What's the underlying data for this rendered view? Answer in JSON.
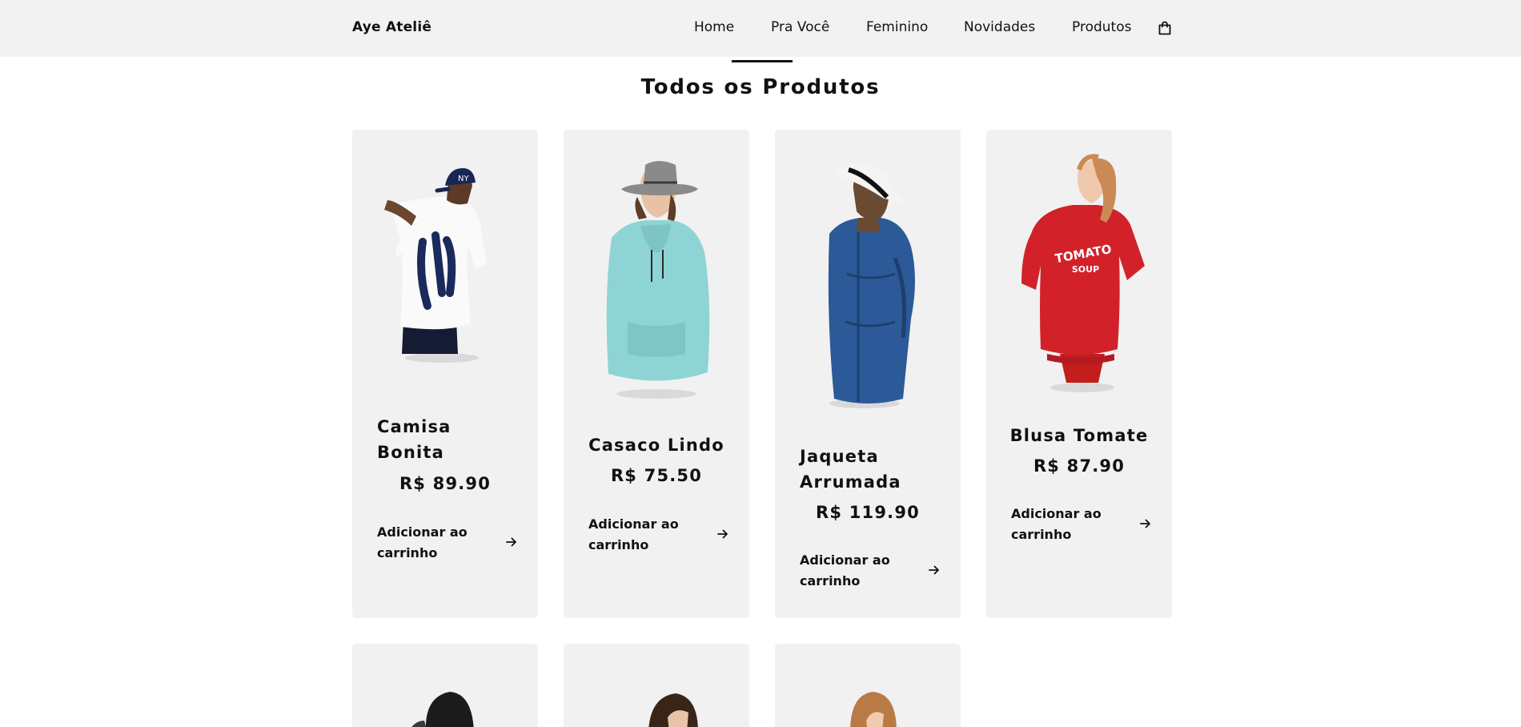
{
  "header": {
    "brand": "Aye Ateliê",
    "nav": [
      {
        "label": "Home"
      },
      {
        "label": "Pra Você"
      },
      {
        "label": "Feminino"
      },
      {
        "label": "Novidades"
      },
      {
        "label": "Produtos"
      }
    ],
    "cart_icon": "shopping-bag-icon"
  },
  "main": {
    "title": "Todos os Produtos",
    "add_to_cart_label": "Adicionar ao carrinho",
    "add_icon": "arrow-right-icon",
    "products": [
      {
        "name": "Camisa Bonita",
        "price": "R$ 89.90",
        "image": "man-white-ny-shirt-cap"
      },
      {
        "name": "Casaco Lindo",
        "price": "R$ 75.50",
        "image": "man-mint-hoodie-hat"
      },
      {
        "name": "Jaqueta Arrumada",
        "price": "R$ 119.90",
        "image": "man-denim-jacket-hat"
      },
      {
        "name": "Blusa Tomate",
        "price": "R$ 87.90",
        "image": "woman-red-tomato-soup-sweatshirt",
        "print": "TOMATO SOUP"
      },
      {
        "image": "person-dark-hair"
      },
      {
        "image": "person-brown-hair"
      },
      {
        "image": "person-curly-blonde-hair"
      }
    ]
  },
  "colors": {
    "header_bg": "#f2f2f2",
    "card_bg": "#f1f1f1",
    "text": "#111111"
  }
}
